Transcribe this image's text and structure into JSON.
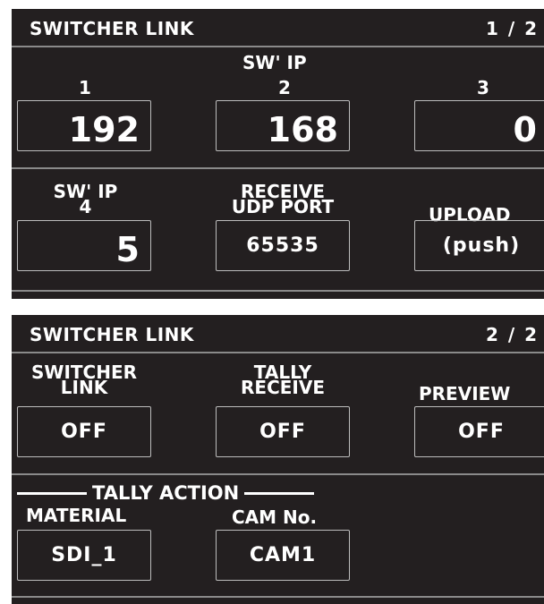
{
  "panel1": {
    "title": "SWITCHER LINK",
    "page": "1 / 2",
    "ip_label": "SW' IP",
    "field1_num": "1",
    "field2_num": "2",
    "field3_num": "3",
    "field1_value": "192",
    "field2_value": "168",
    "field3_value": "0",
    "field4_label_top": "SW' IP",
    "field4_label_num": "4",
    "field4_value": "5",
    "udp_label_line1": "RECEIVE",
    "udp_label_line2": "UDP PORT",
    "udp_value": "65535",
    "upload_label": "UPLOAD",
    "upload_value": "(push)"
  },
  "panel2": {
    "title": "SWITCHER LINK",
    "page": "2 / 2",
    "switcher_label_line1": "SWITCHER",
    "switcher_label_line2": "LINK",
    "switcher_value": "OFF",
    "tally_label_line1": "TALLY",
    "tally_label_line2": "RECEIVE",
    "tally_value": "OFF",
    "preview_label": "PREVIEW",
    "preview_value": "OFF",
    "tally_action_title": "TALLY ACTION",
    "material_label": "MATERIAL",
    "material_value": "SDI_1",
    "cam_label": "CAM No.",
    "cam_value": "CAM1"
  },
  "colors": {
    "background": "#231f20",
    "text": "#ffffff",
    "divider": "#8a8a8a",
    "box_border": "#bcbcbc"
  }
}
